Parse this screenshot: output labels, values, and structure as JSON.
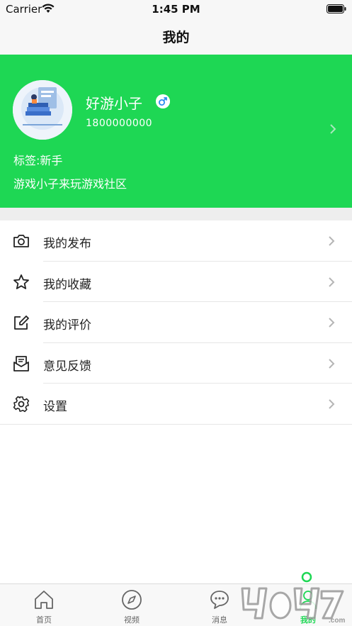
{
  "status_bar": {
    "carrier": "Carrier",
    "time": "1:45 PM"
  },
  "nav": {
    "title": "我的"
  },
  "profile": {
    "username": "好游小子",
    "phone": "1800000000",
    "tag": "标签:新手",
    "motto": "游戏小子来玩游戏社区",
    "gender_icon": "male-icon",
    "bg_color": "#1ed754"
  },
  "menu": {
    "items": [
      {
        "label": "我的发布",
        "icon": "camera-icon"
      },
      {
        "label": "我的收藏",
        "icon": "star-icon"
      },
      {
        "label": "我的评价",
        "icon": "edit-icon"
      },
      {
        "label": "意见反馈",
        "icon": "mail-icon"
      },
      {
        "label": "设置",
        "icon": "gear-icon"
      }
    ]
  },
  "tabbar": {
    "items": [
      {
        "label": "首页",
        "icon": "home-icon"
      },
      {
        "label": "视频",
        "icon": "compass-icon"
      },
      {
        "label": "消息",
        "icon": "chat-icon"
      },
      {
        "label": "我的",
        "icon": "person-icon",
        "active": true
      }
    ]
  },
  "colors": {
    "accent": "#1ed754",
    "separator": "#eeeeee"
  }
}
